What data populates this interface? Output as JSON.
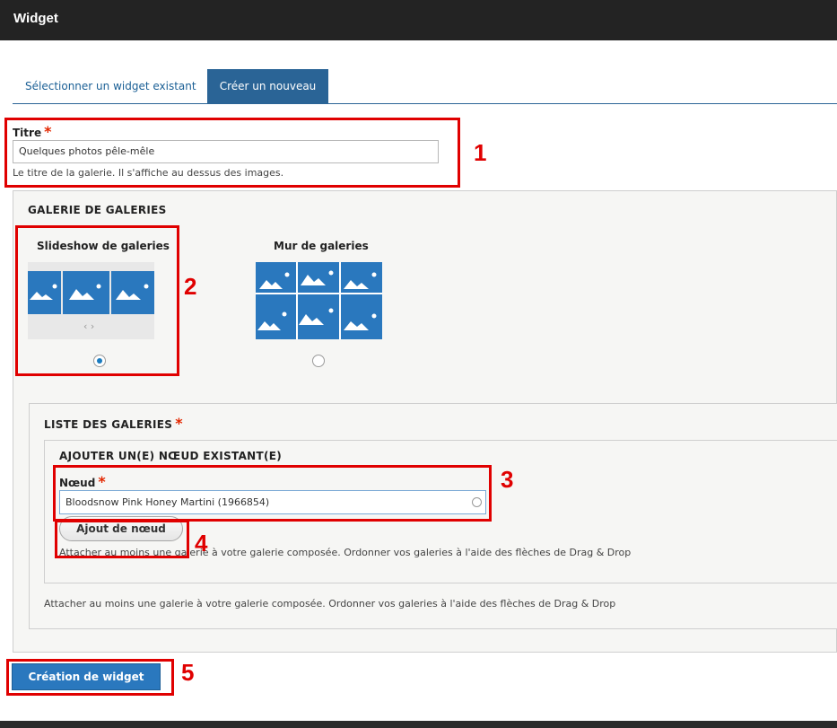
{
  "window": {
    "title": "Widget"
  },
  "tabs": [
    {
      "label": "Sélectionner un widget existant",
      "active": false
    },
    {
      "label": "Créer un nouveau",
      "active": true
    }
  ],
  "titre": {
    "label": "Titre",
    "required_mark": "*",
    "value": "Quelques photos pêle-mêle",
    "description": "Le titre de la galerie. Il s'affiche au dessus des images."
  },
  "galerie_type": {
    "legend": "GALERIE DE GALERIES",
    "options": [
      {
        "label": "Slideshow de galeries",
        "selected": true,
        "carousel_arrows": "‹ ›"
      },
      {
        "label": "Mur de galeries",
        "selected": false
      }
    ]
  },
  "liste": {
    "legend": "LISTE DES GALERIES",
    "required_mark": "*",
    "add_existing": {
      "legend": "AJOUTER UN(E) NŒUD EXISTANT(E)",
      "noeud_label": "Nœud",
      "required_mark": "*",
      "noeud_value": "Bloodsnow Pink Honey Martini (1966854)",
      "add_button": "Ajout de nœud",
      "description": "Attacher au moins une galerie à votre galerie composée. Ordonner vos galeries à l'aide des flèches de Drag & Drop"
    },
    "description": "Attacher au moins une galerie à votre galerie composée. Ordonner vos galeries à l'aide des flèches de Drag & Drop"
  },
  "submit_button": "Création de widget",
  "annotations": [
    "1",
    "2",
    "3",
    "4",
    "5"
  ],
  "colors": {
    "accent": "#2a78be",
    "annotation": "#e00000",
    "required": "#e32700"
  }
}
